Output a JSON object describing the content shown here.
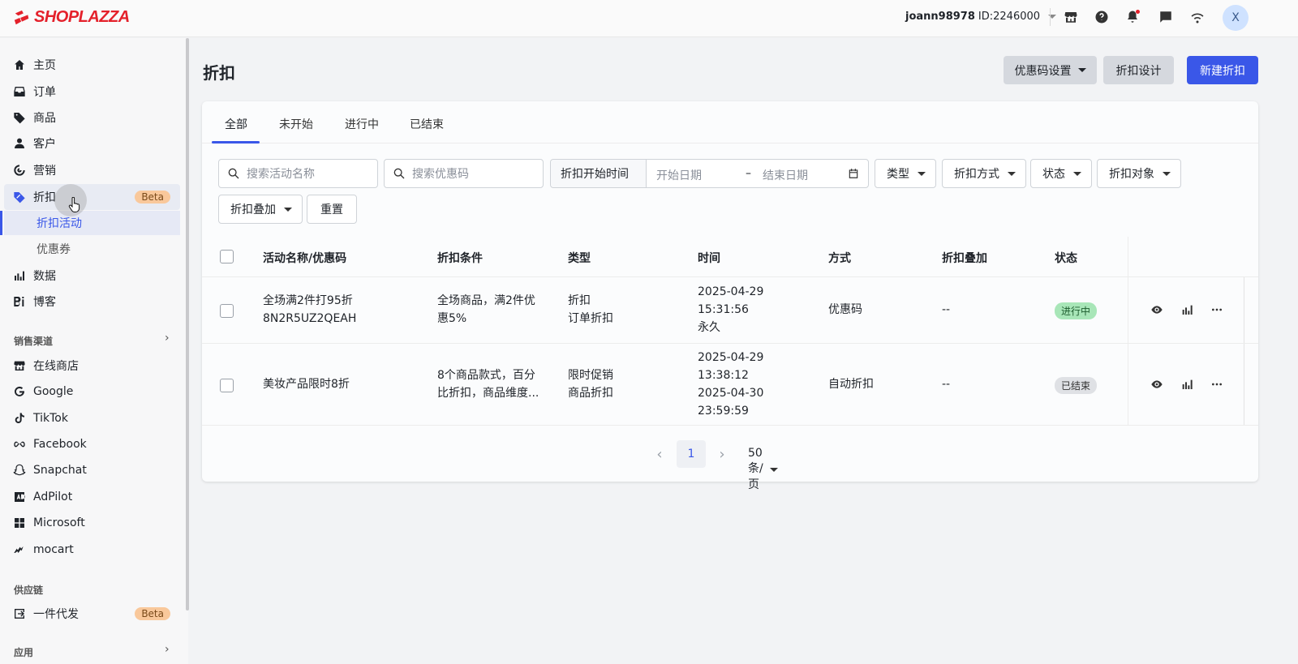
{
  "brand": {
    "name": "SHOPLAZZA",
    "color": "#e4212b"
  },
  "account": {
    "username": "joann98978",
    "id_text": "ID:2246000",
    "avatar_letter": "X"
  },
  "sidebar": {
    "main_items": [
      {
        "label": "主页",
        "icon": "home-icon"
      },
      {
        "label": "订单",
        "icon": "inbox-icon"
      },
      {
        "label": "商品",
        "icon": "tag-icon"
      },
      {
        "label": "客户",
        "icon": "person-icon"
      },
      {
        "label": "营销",
        "icon": "target-icon"
      },
      {
        "label": "折扣",
        "icon": "discount-icon",
        "badge": "Beta"
      }
    ],
    "discount_sub": [
      {
        "label": "折扣活动",
        "active": true
      },
      {
        "label": "优惠券",
        "active": false
      }
    ],
    "more_items": [
      {
        "label": "数据",
        "icon": "bar-chart-icon"
      },
      {
        "label": "博客",
        "icon": "blog-icon"
      }
    ],
    "channels_section": "销售渠道",
    "channels": [
      {
        "label": "在线商店",
        "icon": "store-icon"
      },
      {
        "label": "Google",
        "icon": "google-icon"
      },
      {
        "label": "TikTok",
        "icon": "tiktok-icon"
      },
      {
        "label": "Facebook",
        "icon": "meta-icon"
      },
      {
        "label": "Snapchat",
        "icon": "snapchat-icon"
      },
      {
        "label": "AdPilot",
        "icon": "ad-icon"
      },
      {
        "label": "Microsoft",
        "icon": "windows-icon"
      },
      {
        "label": "mocart",
        "icon": "mocart-icon"
      }
    ],
    "supply_section": "供应链",
    "supply_items": [
      {
        "label": "一件代发",
        "icon": "dropship-icon",
        "badge": "Beta"
      }
    ],
    "apps_section": "应用"
  },
  "page": {
    "title": "折扣",
    "buttons": {
      "coupon_settings": "优惠码设置",
      "discount_design": "折扣设计",
      "new_discount": "新建折扣"
    }
  },
  "tabs": [
    "全部",
    "未开始",
    "进行中",
    "已结束"
  ],
  "filters": {
    "search_name_placeholder": "搜索活动名称",
    "search_code_placeholder": "搜索优惠码",
    "date_label": "折扣开始时间",
    "start_placeholder": "开始日期",
    "date_separator": "–",
    "end_placeholder": "结束日期",
    "type": "类型",
    "method": "折扣方式",
    "status": "状态",
    "target": "折扣对象",
    "stacking": "折扣叠加",
    "reset": "重置"
  },
  "table": {
    "columns": [
      "活动名称/优惠码",
      "折扣条件",
      "类型",
      "时间",
      "方式",
      "折扣叠加",
      "状态"
    ],
    "rows": [
      {
        "name_lines": [
          "全场满2件打95折",
          "8N2R5UZ2QEAH"
        ],
        "condition_lines": [
          "全场商品，满2件优",
          "惠5%"
        ],
        "type_lines": [
          "折扣",
          "订单折扣"
        ],
        "time_lines": [
          "2025-04-29",
          "15:31:56",
          "永久"
        ],
        "method": "优惠码",
        "stacking": "--",
        "status": "进行中",
        "status_color": "#a8e6b8"
      },
      {
        "name_lines": [
          "美妆产品限时8折"
        ],
        "condition_lines": [
          "8个商品款式，百分",
          "比折扣，商品维度..."
        ],
        "type_lines": [
          "限时促销",
          "商品折扣"
        ],
        "time_lines": [
          "2025-04-29",
          "13:38:12",
          "2025-04-30",
          "23:59:59"
        ],
        "method": "自动折扣",
        "stacking": "--",
        "status": "已结束",
        "status_color": "#dfe1e5"
      }
    ]
  },
  "pagination": {
    "current_page": "1",
    "page_size": "50 条/页"
  },
  "colors": {
    "accent": "#3a57e8",
    "sidebar_bg": "#f7f7f8",
    "page_bg": "#f2f3f5"
  }
}
